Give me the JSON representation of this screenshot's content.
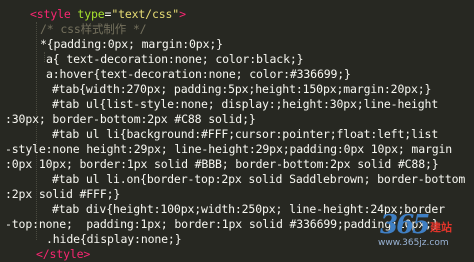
{
  "editor": {
    "background": "#272822",
    "lines": [
      [
        {
          "c": "t-tag",
          "t": "<style "
        },
        {
          "c": "t-attr",
          "t": "type"
        },
        {
          "c": "t-plain",
          "t": "="
        },
        {
          "c": "t-str",
          "t": "\"text/css\""
        },
        {
          "c": "t-tag",
          "t": ">"
        }
      ],
      [
        {
          "c": "t-comment",
          "t": "/* css样式制作 */"
        }
      ],
      [
        {
          "c": "t-plain",
          "t": "*{padding:0px; margin:0px;}"
        }
      ],
      [
        {
          "c": "t-plain",
          "t": "a{ text-decoration:none; color:black;}"
        }
      ],
      [
        {
          "c": "t-plain",
          "t": "a:hover{text-decoration:none; color:#336699;}"
        }
      ],
      [
        {
          "c": "t-plain",
          "t": "#tab{width:270px; padding:5px;height:150px;margin:20px;}"
        }
      ],
      [
        {
          "c": "t-plain",
          "t": "#tab ul{list-style:none; display:;height:30px;line-height"
        }
      ],
      [
        {
          "c": "t-plain",
          "t": ":30px; border-bottom:2px #C88 solid;}"
        }
      ],
      [
        {
          "c": "t-plain",
          "t": "#tab ul li{background:#FFF;cursor:pointer;float:left;list"
        }
      ],
      [
        {
          "c": "t-plain",
          "t": "-style:none height:29px; line-height:29px;padding:0px 10px; margin"
        }
      ],
      [
        {
          "c": "t-plain",
          "t": ":0px 10px; border:1px solid #BBB; border-bottom:2px solid #C88;}"
        }
      ],
      [
        {
          "c": "t-plain",
          "t": "#tab ul li.on{border-top:2px solid Saddlebrown; border-bottom"
        }
      ],
      [
        {
          "c": "t-plain",
          "t": ":2px solid #FFF;}"
        }
      ],
      [
        {
          "c": "t-plain",
          "t": "#tab div{height:100px;width:250px; line-height:24px;border"
        }
      ],
      [
        {
          "c": "t-plain",
          "t": "-top:none;  padding:1px; border:1px solid #336699;padding:10px;}"
        }
      ],
      [
        {
          "c": "t-plain",
          "t": ".hide{display:none;}"
        }
      ],
      [
        {
          "c": "t-tag",
          "t": "</style>"
        }
      ]
    ]
  },
  "watermark": {
    "number": "365",
    "brand": "建站",
    "url": "www.365jz.com"
  }
}
